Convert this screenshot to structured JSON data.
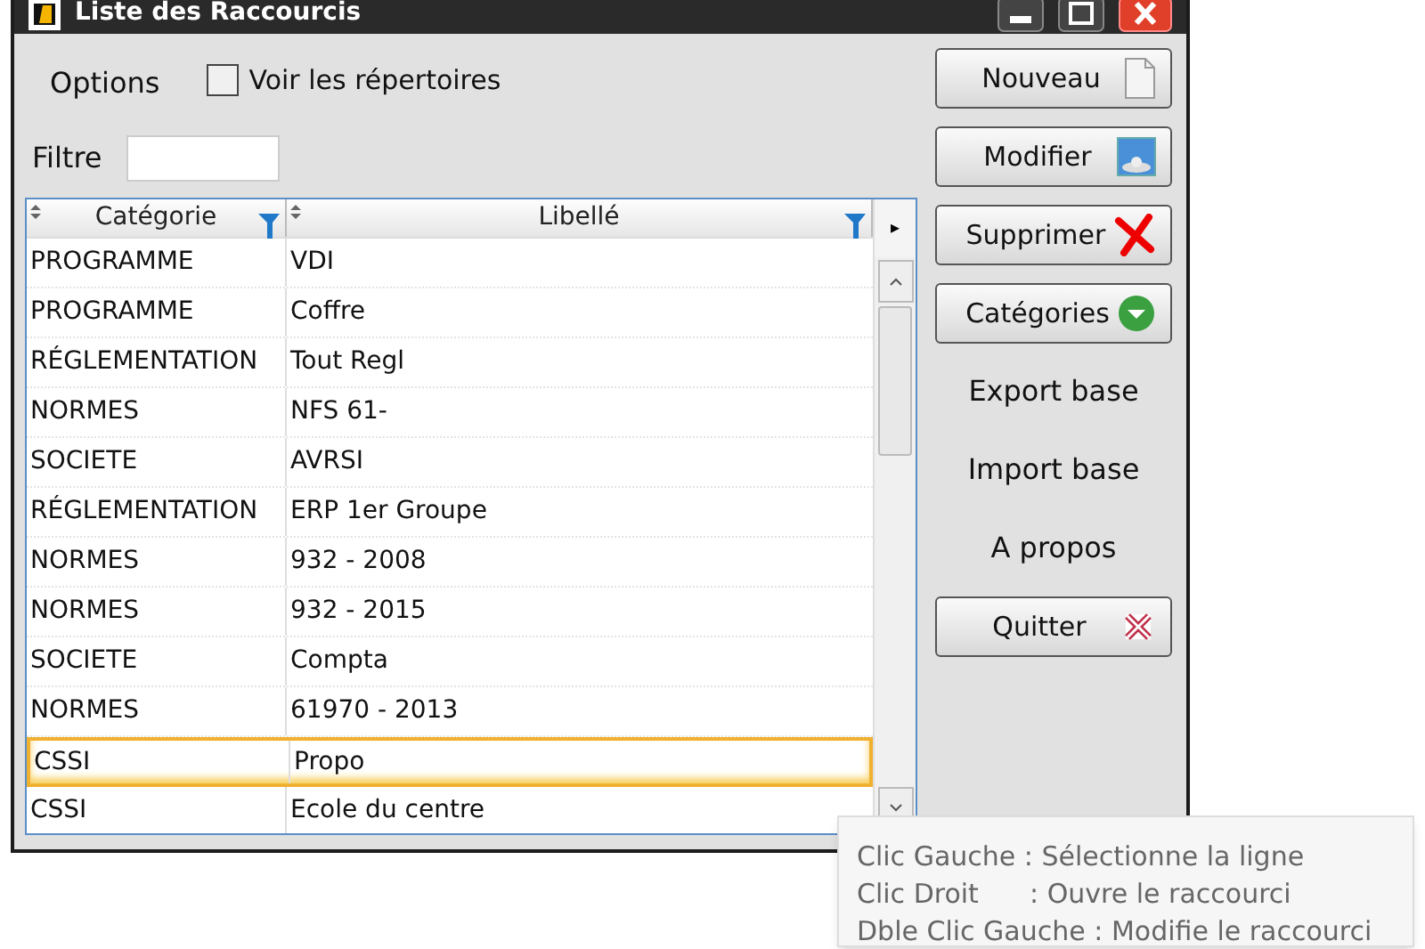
{
  "window": {
    "title": "Liste des Raccourcis"
  },
  "options_label": "Options",
  "show_folders": {
    "label": "Voir les répertoires",
    "checked": false
  },
  "filter": {
    "label": "Filtre"
  },
  "table": {
    "columns": [
      "Catégorie",
      "Libellé"
    ],
    "more_columns_glyph": "▸",
    "rows": [
      {
        "category": "PROGRAMME",
        "label": "VDI",
        "selected": false
      },
      {
        "category": "PROGRAMME",
        "label": "Coffre",
        "selected": false
      },
      {
        "category": "RÉGLEMENTATION",
        "label": "Tout Regl",
        "selected": false
      },
      {
        "category": "NORMES",
        "label": "NFS 61-",
        "selected": false
      },
      {
        "category": "SOCIETE",
        "label": "AVRSI",
        "selected": false
      },
      {
        "category": "RÉGLEMENTATION",
        "label": "ERP 1er Groupe",
        "selected": false
      },
      {
        "category": "NORMES",
        "label": "932 - 2008",
        "selected": false
      },
      {
        "category": "NORMES",
        "label": "932 - 2015",
        "selected": false
      },
      {
        "category": "SOCIETE",
        "label": "Compta",
        "selected": false
      },
      {
        "category": "NORMES",
        "label": "61970 - 2013",
        "selected": false
      },
      {
        "category": "CSSI",
        "label": "Propo",
        "selected": true
      },
      {
        "category": "CSSI",
        "label": "Ecole du centre",
        "selected": false
      }
    ]
  },
  "actions": [
    {
      "kind": "button",
      "label": "Nouveau"
    },
    {
      "kind": "button",
      "label": "Modifier"
    },
    {
      "kind": "button",
      "label": "Supprimer"
    },
    {
      "kind": "button",
      "label": "Catégories"
    },
    {
      "kind": "link",
      "label": "Export base"
    },
    {
      "kind": "link",
      "label": "Import base"
    },
    {
      "kind": "link",
      "label": "A propos"
    },
    {
      "kind": "button",
      "label": "Quitter"
    }
  ],
  "tooltip": [
    "Clic Gauche : Sélectionne la ligne",
    "Clic Droit      : Ouvre le raccourci",
    "Dble Clic Gauche : Modifie le raccourci"
  ]
}
